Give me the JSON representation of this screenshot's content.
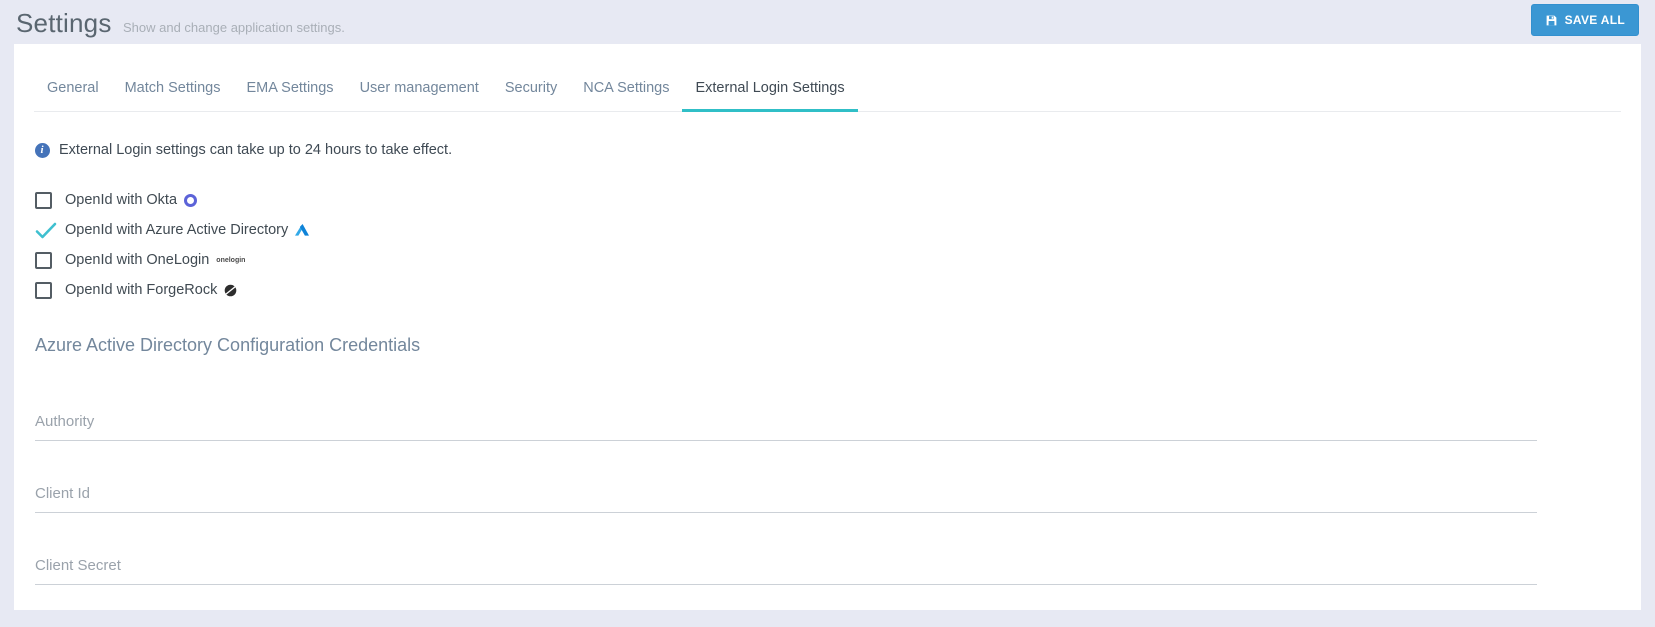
{
  "header": {
    "title": "Settings",
    "subtitle": "Show and change application settings.",
    "save_button_label": "SAVE ALL"
  },
  "tabs": [
    {
      "label": "General",
      "active": false
    },
    {
      "label": "Match Settings",
      "active": false
    },
    {
      "label": "EMA Settings",
      "active": false
    },
    {
      "label": "User management",
      "active": false
    },
    {
      "label": "Security",
      "active": false
    },
    {
      "label": "NCA Settings",
      "active": false
    },
    {
      "label": "External Login Settings",
      "active": true
    }
  ],
  "info": {
    "message": "External Login settings can take up to 24 hours to take effect."
  },
  "providers": [
    {
      "label": "OpenId with Okta",
      "icon": "okta-logo",
      "checked": false
    },
    {
      "label": "OpenId with Azure Active Directory",
      "icon": "azure-logo",
      "checked": true
    },
    {
      "label": "OpenId with OneLogin",
      "icon": "onelogin-logo",
      "checked": false
    },
    {
      "label": "OpenId with ForgeRock",
      "icon": "forgerock-logo",
      "checked": false
    }
  ],
  "onelogin_wordmark": "onelogin",
  "section": {
    "heading": "Azure Active Directory Configuration Credentials"
  },
  "fields": [
    {
      "placeholder": "Authority",
      "value": ""
    },
    {
      "placeholder": "Client Id",
      "value": ""
    },
    {
      "placeholder": "Client Secret",
      "value": ""
    }
  ],
  "colors": {
    "page_background": "#e7e9f3",
    "card_background": "#ffffff",
    "accent_teal": "#30bfc7",
    "button_blue": "#3b97d3",
    "info_blue": "#4573b9",
    "checkmark_cyan": "#3fc0d0",
    "okta_indigo": "#5c63d8",
    "azure_blue": "#1f8fe0",
    "tab_inactive": "#73879c",
    "tab_active": "#3f4a54"
  }
}
